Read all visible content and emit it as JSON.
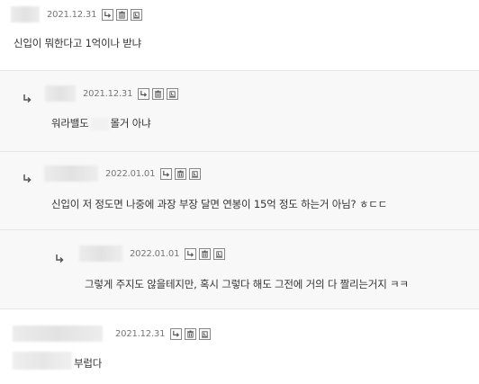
{
  "comments": [
    {
      "date": "2021.12.31",
      "text": "신입이 뭐한다고 1억이나 받냐"
    },
    {
      "date": "2021.12.31",
      "text_before": "워라밸도",
      "text_after": "몰거 아냐"
    },
    {
      "date": "2022.01.01",
      "text": "신입이 저 정도면 나중에 과장 부장 달면 연봉이 15억 정도 하는거 아님? ㅎㄷㄷ"
    },
    {
      "date": "2022.01.01",
      "text": "그렇게 주지도 않을테지만, 혹시 그렇다 해도 그전에 거의 다 짤리는거지 ㅋㅋ"
    },
    {
      "date": "2021.12.31",
      "text": "부럽다"
    }
  ],
  "icons": {
    "reply": "reply-icon",
    "delete": "trash-icon",
    "report": "report-icon",
    "reply_marker": "reply-arrow-icon"
  }
}
